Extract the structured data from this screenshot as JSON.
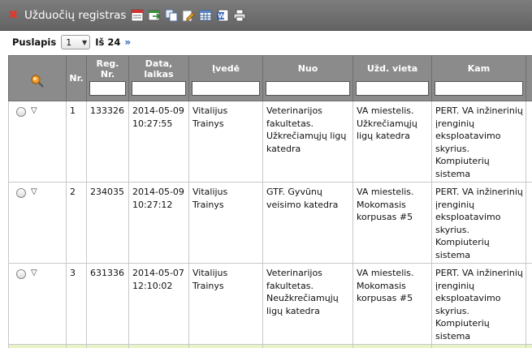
{
  "window": {
    "title": "Užduočių registras"
  },
  "toolbar": {
    "icons": [
      "new-record-icon",
      "export-icon",
      "copy-icon",
      "edit-icon",
      "table-icon",
      "word-icon",
      "print-icon"
    ]
  },
  "pager": {
    "label": "Puslapis",
    "current": "1",
    "of_label": "Iš 24",
    "next": "»"
  },
  "table": {
    "headers": {
      "nr": "Nr.",
      "reg": "Reg. Nr.",
      "date": "Data, laikas",
      "entered": "Įvedė",
      "from": "Nuo",
      "place": "Užd. vieta",
      "to": "Kam"
    },
    "rows": [
      {
        "nr": "1",
        "reg": "133326",
        "date": "2014-05-09 10:27:55",
        "entered": "Vitalijus Trainys",
        "from": "Veterinarijos fakultetas. Užkrečiamųjų ligų katedra",
        "place": "VA miestelis. Užkrečiamųjų ligų katedra",
        "to": "PERT. VA inžinerinių įrenginių eksploatavimo skyrius. Kompiuterių sistema"
      },
      {
        "nr": "2",
        "reg": "234035",
        "date": "2014-05-09 10:27:12",
        "entered": "Vitalijus Trainys",
        "from": "GTF. Gyvūnų veisimo katedra",
        "place": "VA miestelis. Mokomasis korpusas #5",
        "to": "PERT. VA inžinerinių įrenginių eksploatavimo skyrius. Kompiuterių sistema"
      },
      {
        "nr": "3",
        "reg": "631336",
        "date": "2014-05-07 12:10:02",
        "entered": "Vitalijus Trainys",
        "from": "Veterinarijos fakultetas. Neužkrečiamųjų ligų katedra",
        "place": "VA miestelis. Mokomasis korpusas #5",
        "to": "PERT. VA inžinerinių įrenginių eksploatavimo skyrius. Kompiuterių sistema"
      }
    ]
  },
  "colors": {
    "titlebar": "#6f6f6f",
    "header": "#8b8b8b",
    "close": "#e23a2a",
    "link": "#1a5fb4"
  }
}
